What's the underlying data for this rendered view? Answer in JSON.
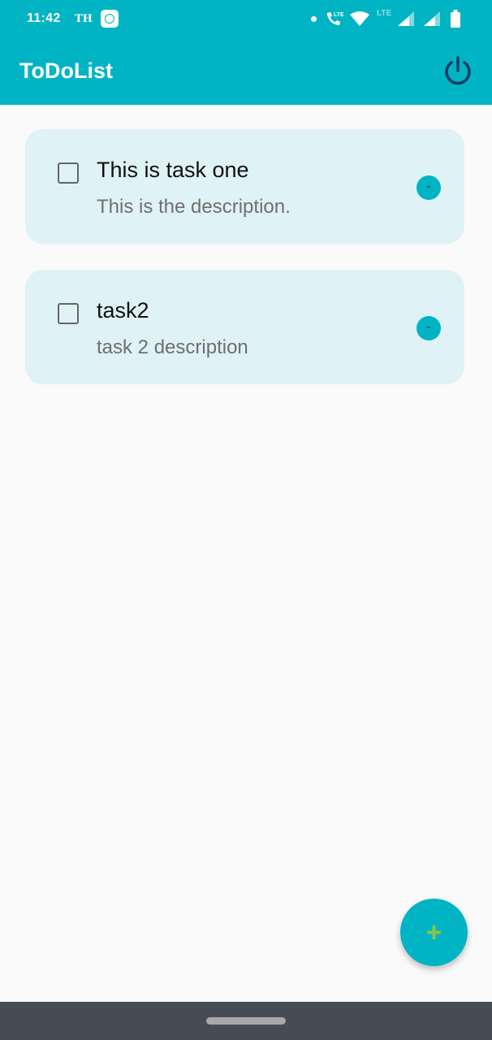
{
  "status_bar": {
    "time": "11:42",
    "carrier": "TH",
    "lte_label": "LTE",
    "lte_dim_label": "LTE"
  },
  "app_bar": {
    "title": "ToDoList",
    "power_icon": "power-icon"
  },
  "tasks": [
    {
      "title": "This is task one",
      "description": "This is the description.",
      "remove_label": "-"
    },
    {
      "title": "task2",
      "description": "task 2 description",
      "remove_label": "-"
    }
  ],
  "fab": {
    "icon": "plus-icon"
  },
  "colors": {
    "primary": "#00b4c3",
    "card_background": "#dff2f6",
    "fab_plus": "#8bc34a",
    "power_icon": "#0d3b66",
    "nav_bar": "#474c54"
  }
}
